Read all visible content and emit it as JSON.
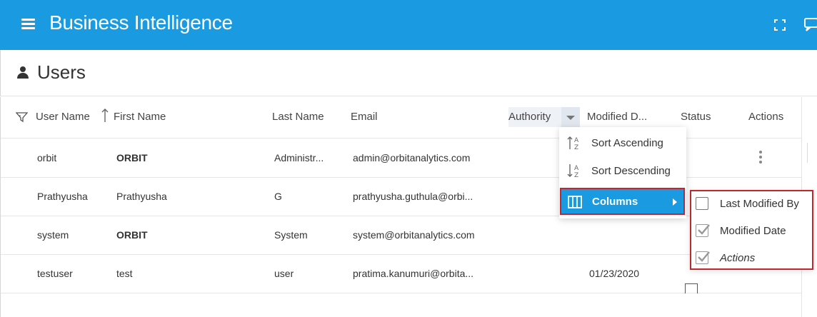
{
  "header": {
    "title": "Business Intelligence",
    "bg_color": "#1a9ae0",
    "icons": [
      "menu-icon",
      "fullscreen-icon",
      "chat-icon"
    ]
  },
  "page": {
    "title": "Users",
    "icon": "user-icon"
  },
  "table": {
    "columns": [
      {
        "key": "username",
        "label": "User Name"
      },
      {
        "key": "firstname",
        "label": "First Name"
      },
      {
        "key": "lastname",
        "label": "Last Name"
      },
      {
        "key": "email",
        "label": "Email"
      },
      {
        "key": "authority",
        "label": "Authority"
      },
      {
        "key": "modified",
        "label": "Modified D..."
      },
      {
        "key": "status",
        "label": "Status"
      },
      {
        "key": "actions",
        "label": "Actions"
      }
    ],
    "rows": [
      {
        "username": "orbit",
        "firstname": "ORBIT",
        "lastname": "Administr...",
        "email": "admin@orbitanalytics.com",
        "modified": ""
      },
      {
        "username": "Prathyusha",
        "firstname": "Prathyusha",
        "lastname": "G",
        "email": "prathyusha.guthula@orbi...",
        "modified": ""
      },
      {
        "username": "system",
        "firstname": "ORBIT",
        "lastname": "System",
        "email": "system@orbitanalytics.com",
        "modified": ""
      },
      {
        "username": "testuser",
        "firstname": "test",
        "lastname": "user",
        "email": "pratima.kanumuri@orbita...",
        "modified": "01/23/2020"
      }
    ]
  },
  "column_menu": {
    "items": [
      {
        "label": "Sort Ascending",
        "icon": "sort-ascending-icon"
      },
      {
        "label": "Sort Descending",
        "icon": "sort-descending-icon"
      },
      {
        "label": "Columns",
        "icon": "columns-icon",
        "active": true
      }
    ],
    "highlight_color": "#c0282e"
  },
  "columns_submenu": {
    "items": [
      {
        "label": "Last Modified By",
        "checked": false
      },
      {
        "label": "Modified Date",
        "checked": true
      },
      {
        "label": "Actions",
        "checked": true
      }
    ]
  }
}
